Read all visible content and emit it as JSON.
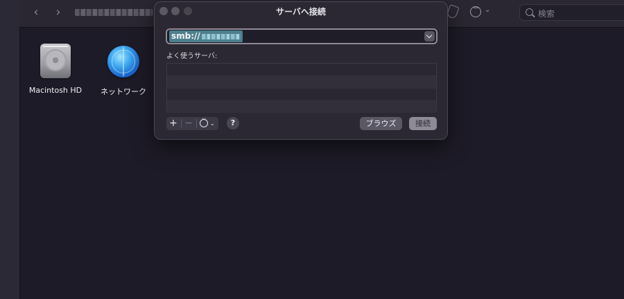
{
  "finder": {
    "search_placeholder": "検索",
    "desktop_items": [
      {
        "label": "Macintosh HD",
        "icon": "hard-drive-icon"
      },
      {
        "label": "ネットワーク",
        "icon": "network-globe-icon"
      }
    ]
  },
  "dialog": {
    "title": "サーバへ接続",
    "server_address_value": "smb://",
    "favorites_label": "よく使うサーバ:",
    "favorites_rows": 4,
    "buttons": {
      "add": "+",
      "remove": "−",
      "help": "?",
      "browse": "ブラウズ",
      "connect": "接続"
    }
  },
  "colors": {
    "background": "#1e1b28",
    "dialog": "#2b2833",
    "selection": "#4e7f8e"
  }
}
